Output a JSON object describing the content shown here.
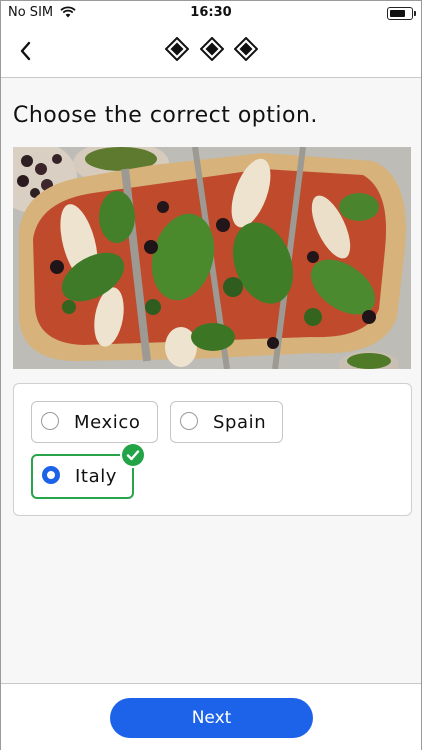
{
  "status_bar": {
    "carrier": "No SIM",
    "time": "16:30",
    "icons": [
      "wifi-icon",
      "battery-icon"
    ]
  },
  "nav": {
    "back_icon": "chevron-left-icon",
    "progress_icons": [
      "diamond-icon",
      "diamond-icon",
      "diamond-icon"
    ]
  },
  "question": {
    "prompt": "Choose the correct option.",
    "image": "pizza-with-spinach-and-olives-photo"
  },
  "options": [
    {
      "label": "Mexico",
      "selected": false
    },
    {
      "label": "Spain",
      "selected": false
    },
    {
      "label": "Italy",
      "selected": true,
      "correct": true
    }
  ],
  "footer": {
    "next_label": "Next"
  },
  "colors": {
    "accent": "#1d63e9",
    "correct": "#22a447"
  }
}
